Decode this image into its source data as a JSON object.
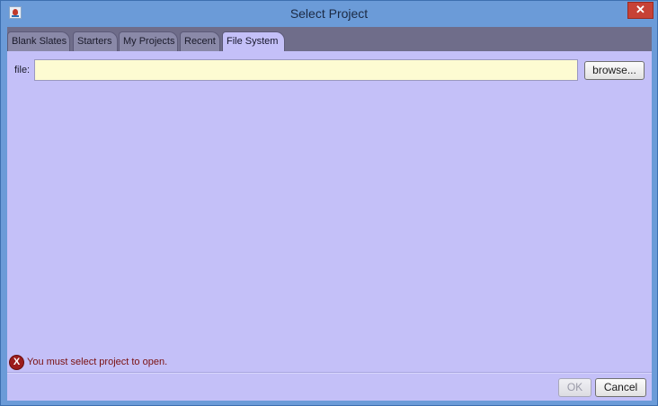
{
  "window": {
    "title": "Select Project",
    "close_glyph": "✕"
  },
  "tabs": [
    {
      "label": "Blank Slates",
      "active": false
    },
    {
      "label": "Starters",
      "active": false
    },
    {
      "label": "My Projects",
      "active": false
    },
    {
      "label": "Recent",
      "active": false
    },
    {
      "label": "File System",
      "active": true
    }
  ],
  "file_field": {
    "label": "file:",
    "value": "",
    "placeholder": ""
  },
  "browse_label": "browse...",
  "error": {
    "icon_glyph": "X",
    "message": "You must select project to open."
  },
  "footer": {
    "ok_label": "OK",
    "ok_enabled": false,
    "cancel_label": "Cancel"
  },
  "colors": {
    "titlebar": "#6b9bd8",
    "panel": "#c4c0f8",
    "tabstrip": "#6f6d8a",
    "input_bg": "#fdfbd2",
    "close": "#c74236",
    "error": "#9c1c1c"
  }
}
